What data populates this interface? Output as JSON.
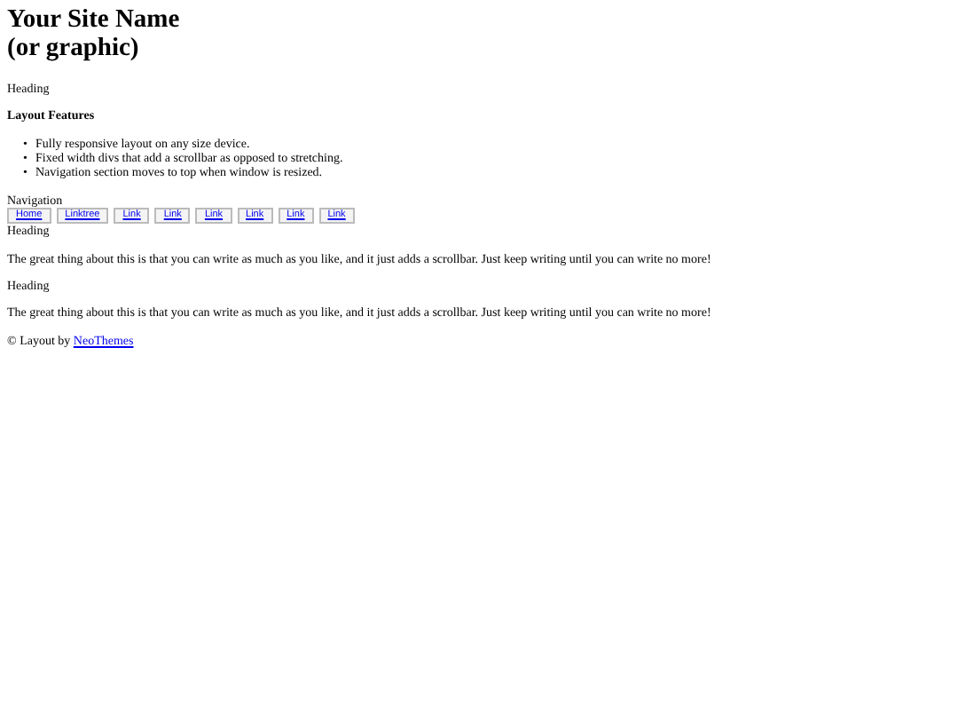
{
  "site_name": [
    "Your Site Name",
    "(or graphic)"
  ],
  "sidebar": {
    "heading": "Heading",
    "features_title": "Layout Features",
    "features": [
      {
        "bullet": "•",
        "text": "Fully responsive layout on any size device."
      },
      {
        "bullet": "•",
        "text": "Fixed width divs that add a scrollbar as opposed to stretching."
      },
      {
        "bullet": "•",
        "text": "Navigation section moves to top when window is resized."
      }
    ]
  },
  "navigation": {
    "label": "Navigation",
    "links": [
      "Home",
      "Linktree",
      "Link",
      "Link",
      "Link",
      "Link",
      "Link",
      "Link"
    ]
  },
  "sections": [
    {
      "heading": "Heading",
      "text": "The great thing about this is that you can write as much as you like, and it just adds a scrollbar. Just keep writing until you can write no more!"
    },
    {
      "heading": "Heading",
      "text": "The great thing about this is that you can write as much as you like, and it just adds a scrollbar. Just keep writing until you can write no more!"
    }
  ],
  "footer": {
    "text": "© Layout by",
    "link": "NeoThemes"
  }
}
